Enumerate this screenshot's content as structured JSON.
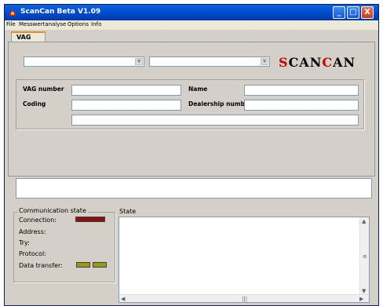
{
  "window": {
    "title": "ScanCan  Beta V1.09"
  },
  "titlebar_buttons": {
    "minimize": "_",
    "maximize": "□",
    "close": "X"
  },
  "menu": [
    "File",
    "Messwertanalyse",
    "Options",
    "Info"
  ],
  "tabs": [
    {
      "label": "VAG",
      "active": true
    }
  ],
  "combos": {
    "left_value": "",
    "right_value": ""
  },
  "logo": {
    "parts": [
      "S",
      "CAN",
      "C",
      "AN"
    ],
    "colors": [
      "#c00000",
      "#000000",
      "#c00000",
      "#000000"
    ]
  },
  "vag_fields": {
    "vag_number_label": "VAG number",
    "name_label": "Name",
    "coding_label": "Coding",
    "dealership_label": "Dealership numbe",
    "vag_number_value": "",
    "name_value": "",
    "coding_value": "",
    "dealership_value": "",
    "extra_value": ""
  },
  "message_box": "",
  "communication": {
    "legend": "Communication state",
    "connection_label": "Connection:",
    "address_label": "Address:",
    "try_label": "Try:",
    "protocol_label": "Protocol:",
    "data_transfer_label": "Data transfer:",
    "connection_led_color": "#8b1010",
    "data_led_color": "#9a9a18"
  },
  "state": {
    "label": "State",
    "text": ""
  }
}
